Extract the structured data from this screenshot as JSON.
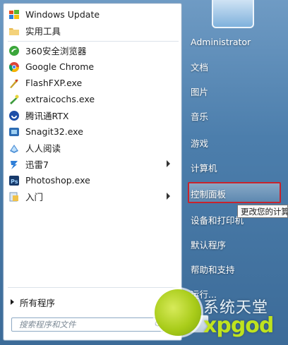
{
  "programs": [
    {
      "label": "Windows Update",
      "icon": "windows-update-icon"
    },
    {
      "label": "实用工具",
      "icon": "folder-icon"
    },
    {
      "label": "360安全浏览器",
      "icon": "browser-360-icon"
    },
    {
      "label": "Google Chrome",
      "icon": "chrome-icon"
    },
    {
      "label": "FlashFXP.exe",
      "icon": "flashfxp-icon"
    },
    {
      "label": "extraicochs.exe",
      "icon": "extraicochs-icon"
    },
    {
      "label": "腾讯通RTX",
      "icon": "rtx-icon"
    },
    {
      "label": "Snagit32.exe",
      "icon": "snagit-icon"
    },
    {
      "label": "人人阅读",
      "icon": "reader-icon"
    },
    {
      "label": "迅雷7",
      "icon": "thunder-icon"
    },
    {
      "label": "Photoshop.exe",
      "icon": "photoshop-icon"
    },
    {
      "label": "入门",
      "icon": "getting-started-icon"
    }
  ],
  "all_programs": "所有程序",
  "search": {
    "placeholder": "搜索程序和文件"
  },
  "right_links": [
    {
      "label": "Administrator"
    },
    {
      "label": "文档"
    },
    {
      "label": "图片"
    },
    {
      "label": "音乐"
    },
    {
      "label": "游戏"
    },
    {
      "label": "计算机"
    },
    {
      "label": "控制面板"
    },
    {
      "label": "设备和打印机"
    },
    {
      "label": "默认程序"
    },
    {
      "label": "帮助和支持"
    },
    {
      "label": "运行..."
    }
  ],
  "tooltip": "更改您的计算",
  "watermark": {
    "top": "系统天堂",
    "bottom": "xpgod"
  },
  "colors": {
    "highlight_border": "#c8232c",
    "watermark_green": "#bfe31e"
  }
}
